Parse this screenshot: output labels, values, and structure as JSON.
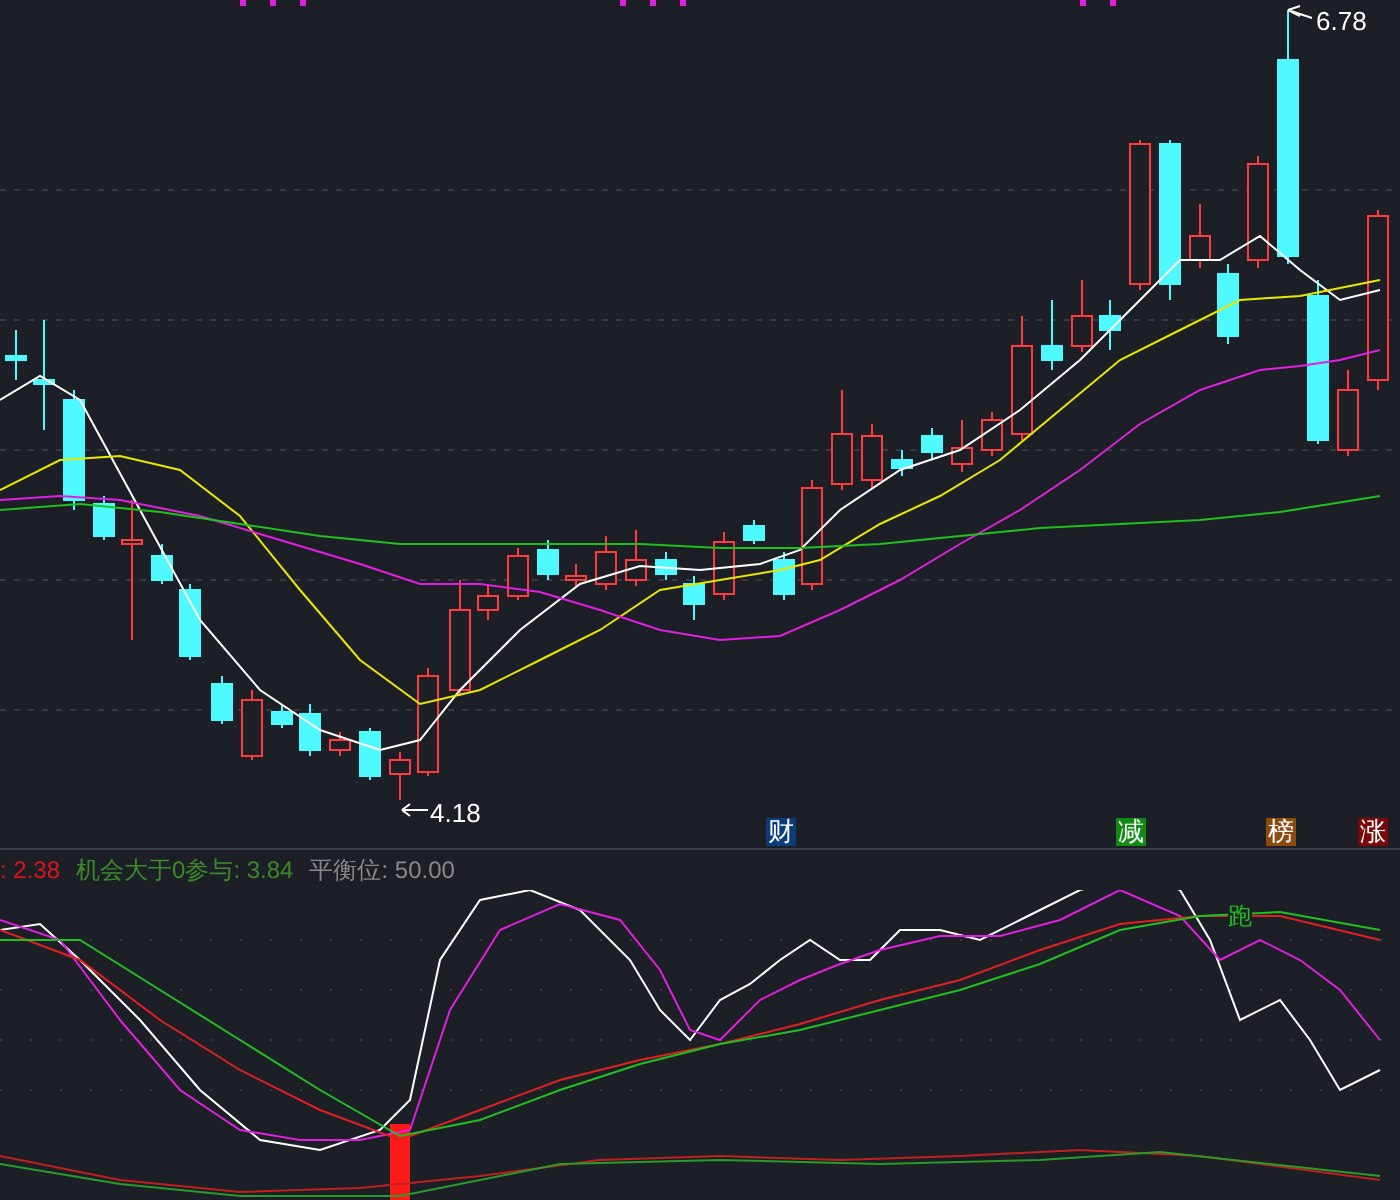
{
  "price_chart": {
    "high_label": "6.78",
    "low_label": "4.18",
    "event_badges": [
      {
        "text": "财",
        "color": "#0a3d7a"
      },
      {
        "text": "减",
        "color": "#138a13"
      },
      {
        "text": "榜",
        "color": "#8a4a10"
      },
      {
        "text": "涨",
        "color": "#7a0a0a"
      }
    ]
  },
  "indicator_legend": [
    {
      "text": ": 2.38",
      "color": "#e0131a"
    },
    {
      "text": "机会大于0参与: 3.84",
      "color": "#3a8a2a"
    },
    {
      "text": "平衡位: 50.00",
      "color": "#8a8a8a"
    }
  ],
  "indicator_chart": {
    "signal_label": "跑"
  }
}
